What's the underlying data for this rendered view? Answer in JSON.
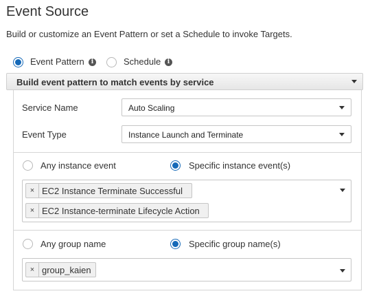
{
  "header": {
    "title": "Event Source",
    "description": "Build or customize an Event Pattern or set a Schedule to invoke Targets."
  },
  "source_mode": {
    "options": [
      {
        "label": "Event Pattern",
        "checked": true,
        "info_icon": "info-icon"
      },
      {
        "label": "Schedule",
        "checked": false,
        "info_icon": "info-icon"
      }
    ]
  },
  "pattern_builder": {
    "label": "Build event pattern to match events by service"
  },
  "service_name": {
    "label": "Service Name",
    "value": "Auto Scaling"
  },
  "event_type": {
    "label": "Event Type",
    "value": "Instance Launch and Terminate"
  },
  "instance_events": {
    "any_label": "Any instance event",
    "specific_label": "Specific instance event(s)",
    "specific_checked": true,
    "tags": [
      "EC2 Instance Terminate Successful",
      "EC2 Instance-terminate Lifecycle Action"
    ]
  },
  "group_names": {
    "any_label": "Any group name",
    "specific_label": "Specific group name(s)",
    "specific_checked": true,
    "tags": [
      "group_kaien"
    ]
  },
  "tag_remove_symbol": "×",
  "info_symbol": "i",
  "colors": {
    "accent": "#1569b8",
    "header_bg": "#eeeeee",
    "border": "#d5d5d5"
  }
}
